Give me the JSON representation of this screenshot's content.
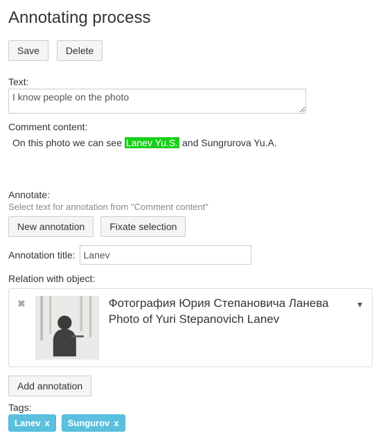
{
  "page": {
    "title": "Annotating process"
  },
  "toolbar": {
    "save": "Save",
    "delete": "Delete"
  },
  "text_field": {
    "label": "Text:",
    "value": "I know people on the photo"
  },
  "comment": {
    "label": "Comment content:",
    "before": "On this photo we can see ",
    "highlight": "Lanev Yu.S.",
    "after": " and Sungrurova Yu.A."
  },
  "annotate": {
    "label": "Annotate:",
    "helper": "Select text for annotation from \"Comment content\"",
    "new_btn": "New annotation",
    "fixate_btn": "Fixate selection"
  },
  "annotation_title": {
    "label": "Annotation title:",
    "value": "Lanev"
  },
  "relation": {
    "label": "Relation with object:",
    "title_ru": "Фотография Юрия Степановича Ланева",
    "title_en": "Photo of Yuri Stepanovich Lanev"
  },
  "add_annotation": "Add annotation",
  "tags": {
    "label": "Tags:",
    "items": [
      "Lanev",
      "Sungurov"
    ]
  }
}
